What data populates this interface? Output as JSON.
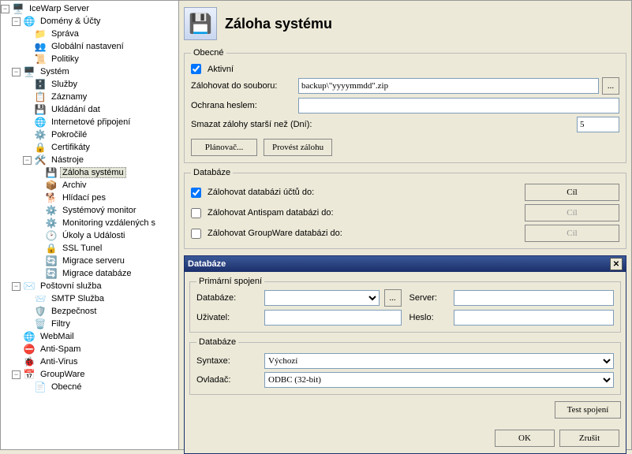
{
  "tree": {
    "root": "IceWarp Server",
    "domains": "Domény & Účty",
    "sprava": "Správa",
    "glob": "Globální nastavení",
    "politiky": "Politiky",
    "system": "Systém",
    "sluzby": "Služby",
    "zaznamy": "Záznamy",
    "ukladani": "Ukládání dat",
    "internet": "Internetové připojení",
    "pokrocile": "Pokročilé",
    "cert": "Certifikáty",
    "nastroje": "Nástroje",
    "zaloha": "Záloha systému",
    "archiv": "Archiv",
    "hlidaci": "Hlídací pes",
    "sysmon": "Systémový monitor",
    "monvzdal": "Monitoring vzdálených s",
    "ukoly": "Úkoly a Události",
    "ssl": "SSL Tunel",
    "migserv": "Migrace serveru",
    "migdb": "Migrace databáze",
    "posta": "Poštovní služba",
    "smtp": "SMTP Služba",
    "bezp": "Bezpečnost",
    "filtry": "Filtry",
    "webmail": "WebMail",
    "antispam": "Anti-Spam",
    "antivirus": "Anti-Virus",
    "groupware": "GroupWare",
    "obecne_gw": "Obecné"
  },
  "header": {
    "title": "Záloha systému"
  },
  "general": {
    "legend": "Obecné",
    "active": "Aktivní",
    "backup_to_label": "Zálohovat do souboru:",
    "backup_to_value": "backup\\\"yyyymmdd\".zip",
    "password_label": "Ochrana heslem:",
    "password_value": "",
    "delete_old_label": "Smazat zálohy starší než (Dní):",
    "delete_old_value": "5",
    "scheduler_btn": "Plánovač...",
    "runbackup_btn": "Provést zálohu",
    "browse_btn": "..."
  },
  "db": {
    "legend": "Databáze",
    "accounts_chk": "Zálohovat databázi účtů do:",
    "antispam_chk": "Zálohovat Antispam databázi do:",
    "groupware_chk": "Zálohovat GroupWare databázi do:",
    "target_btn": "Cíl"
  },
  "dialog": {
    "title": "Databáze",
    "primary_legend": "Primární spojení",
    "db_label": "Databáze:",
    "server_label": "Server:",
    "user_label": "Uživatel:",
    "pass_label": "Heslo:",
    "browse": "...",
    "db2_legend": "Databáze",
    "syntax_label": "Syntaxe:",
    "syntax_value": "Výchozí",
    "driver_label": "Ovladač:",
    "driver_value": "ODBC (32-bit)",
    "test_btn": "Test spojení",
    "ok": "OK",
    "cancel": "Zrušit"
  }
}
